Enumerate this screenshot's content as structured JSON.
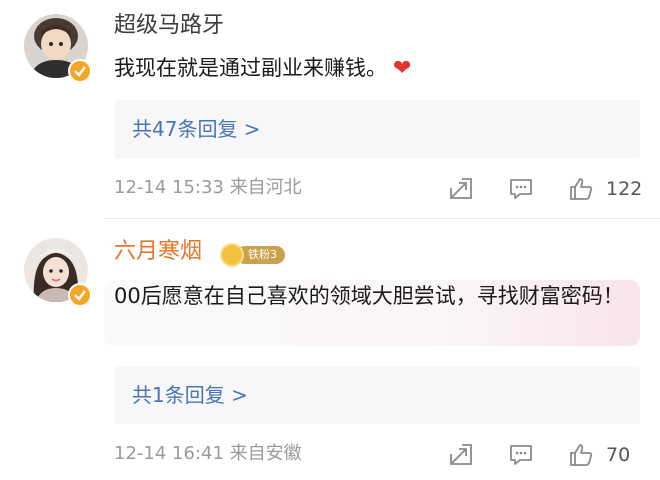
{
  "comments": [
    {
      "username": "超级马路牙",
      "text": "我现在就是通过副业来赚钱。",
      "emoji": "❤",
      "replies": "共47条回复 >",
      "meta": "12-14 15:33 来自河北",
      "likes": "122"
    },
    {
      "username": "六月寒烟",
      "badge": "铁粉3",
      "text": "00后愿意在自己喜欢的领域大胆尝试，寻找财富密码！",
      "replies": "共1条回复 >",
      "meta": "12-14 16:41 来自安徽",
      "likes": "70"
    }
  ],
  "colors": {
    "link": "#4a74b8",
    "username_highlight": "#e8742a",
    "verified": "#f5a623",
    "heart": "#e5312f"
  },
  "icons": [
    "verified-badge-icon",
    "share-icon",
    "comment-icon",
    "like-icon",
    "heart-emoji-icon"
  ]
}
